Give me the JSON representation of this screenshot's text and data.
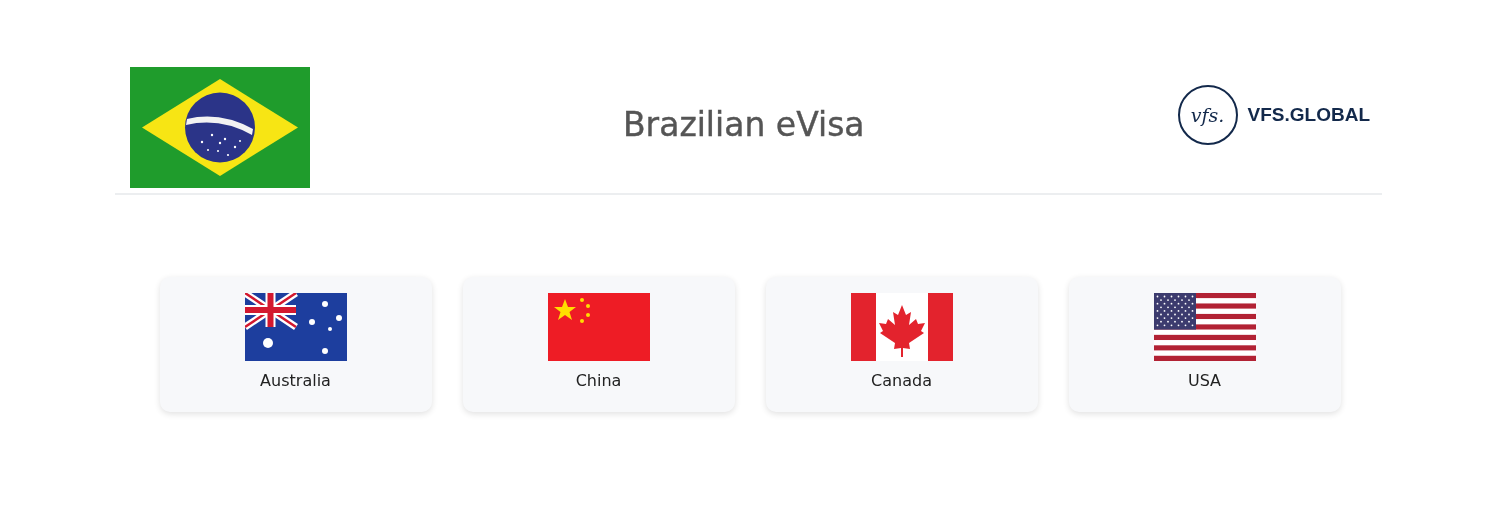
{
  "header": {
    "kind": "brazil",
    "title": "Brazilian eVisa",
    "logo": {
      "mark": "vfs.",
      "name": "VFS.GLOBAL"
    }
  },
  "countries": [
    {
      "name": "Australia",
      "kind": "australia"
    },
    {
      "name": "China",
      "kind": "china"
    },
    {
      "name": "Canada",
      "kind": "canada"
    },
    {
      "name": "USA",
      "kind": "usa"
    }
  ]
}
